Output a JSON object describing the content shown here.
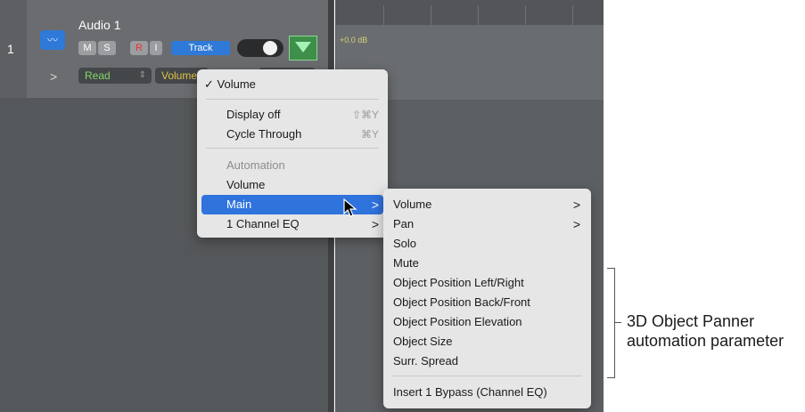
{
  "track": {
    "number": "1",
    "name": "Audio 1",
    "mute": "M",
    "solo": "S",
    "record": "R",
    "input": "I",
    "track_button": "Track",
    "automation_mode": "Read",
    "automation_param": "Volume",
    "gain_readout": "+0.0 dB",
    "disclosure": ">"
  },
  "menu": {
    "checked_item": "Volume",
    "display_off": "Display off",
    "display_off_shortcut": "⇧⌘Y",
    "cycle_through": "Cycle Through",
    "cycle_through_shortcut": "⌘Y",
    "automation_header": "Automation",
    "volume": "Volume",
    "main": "Main",
    "channel_eq": "1 Channel EQ",
    "chevron": ">",
    "checkmark": "✓"
  },
  "submenu": {
    "items": [
      "Volume",
      "Pan",
      "Solo",
      "Mute",
      "Object Position Left/Right",
      "Object Position Back/Front",
      "Object Position Elevation",
      "Object Size",
      "Surr. Spread"
    ],
    "bypass": "Insert 1 Bypass (Channel EQ)",
    "chevron": ">"
  },
  "annotation": {
    "line1": "3D Object Panner",
    "line2": "automation parameter"
  },
  "colors": {
    "highlight": "#2f73dd",
    "read_mode": "#82d66a",
    "param": "#e0c34a"
  }
}
